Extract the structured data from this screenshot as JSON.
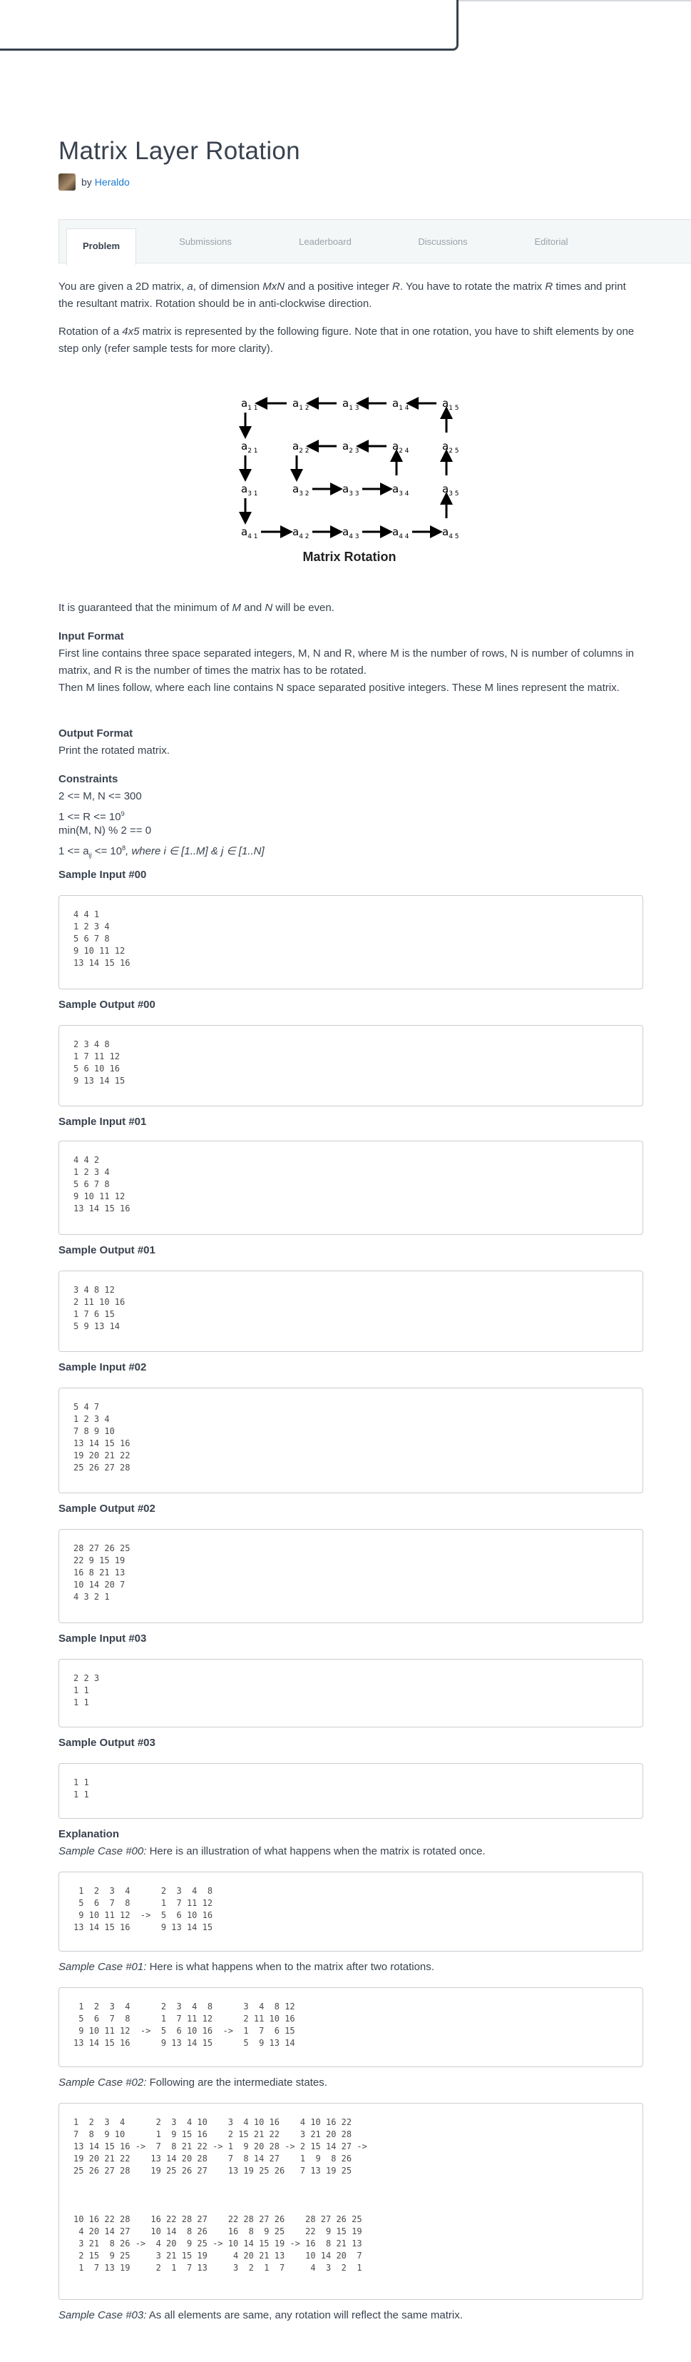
{
  "title": "Matrix Layer Rotation",
  "byline": {
    "prefix": "by",
    "author": "Heraldo"
  },
  "tabs": [
    "Problem",
    "Submissions",
    "Leaderboard",
    "Discussions",
    "Editorial"
  ],
  "intro": {
    "p1a": "You are given a 2D matrix, ",
    "p1_a": "a",
    "p1b": ", of dimension ",
    "p1_mxn": "MxN",
    "p1c": " and a positive integer ",
    "p1_r": "R",
    "p1d": ". You have to rotate the matrix ",
    "p1_r2": "R",
    "p1e": " times and print the resultant matrix. Rotation should be in anti-clockwise direction.",
    "p2a": "Rotation of a ",
    "p2_4x5": "4x5",
    "p2b": " matrix is represented by the following figure. Note that in one rotation, you have to shift elements by one step only (refer sample tests for more clarity)."
  },
  "figure": {
    "caption": "Matrix Rotation"
  },
  "guarantee": {
    "a": "It is guaranteed that the minimum of ",
    "m": "M",
    "b": " and ",
    "n": "N",
    "c": " will be even."
  },
  "input_format": {
    "heading": "Input Format",
    "l1": "First line contains three space separated integers, M, N and R, where M is the number of rows, N is number of columns in matrix, and R is the number of times the matrix has to be rotated.",
    "l2": "Then M lines follow, where each line contains N space separated positive integers. These M lines represent the matrix."
  },
  "output_format": {
    "heading": "Output Format",
    "text": "Print the rotated matrix."
  },
  "constraints": {
    "heading": "Constraints",
    "c1": "2 <= M, N <= 300",
    "c2": "1 <= R <= 10",
    "c2_sup": "9",
    "c3": "min(M, N) % 2 == 0",
    "c4a": "1 <= a",
    "c4_sub": "ij",
    "c4b": " <= 10",
    "c4_sup": "8",
    "c4c": ", where i ∈ [1..M] & j ∈ [1..N]"
  },
  "samples": [
    {
      "heading": "Sample Input #00",
      "code": "4 4 1\n1 2 3 4\n5 6 7 8\n9 10 11 12\n13 14 15 16"
    },
    {
      "heading": "Sample Output #00",
      "code": "2 3 4 8\n1 7 11 12\n5 6 10 16\n9 13 14 15"
    },
    {
      "heading": "Sample Input #01",
      "code": "4 4 2\n1 2 3 4\n5 6 7 8\n9 10 11 12\n13 14 15 16"
    },
    {
      "heading": "Sample Output #01",
      "code": "3 4 8 12\n2 11 10 16\n1 7 6 15\n5 9 13 14"
    },
    {
      "heading": "Sample Input #02",
      "code": "5 4 7\n1 2 3 4\n7 8 9 10\n13 14 15 16\n19 20 21 22\n25 26 27 28"
    },
    {
      "heading": "Sample Output #02",
      "code": "28 27 26 25\n22 9 15 19\n16 8 21 13\n10 14 20 7\n4 3 2 1"
    },
    {
      "heading": "Sample Input #03",
      "code": "2 2 3\n1 1\n1 1"
    },
    {
      "heading": "Sample Output #03",
      "code": "1 1\n1 1"
    }
  ],
  "explanation": {
    "heading": "Explanation",
    "case0_label": "Sample Case #00:",
    "case0_text": " Here is an illustration of what happens when the matrix is rotated once.",
    "case0_code": " 1  2  3  4      2  3  4  8\n 5  6  7  8      1  7 11 12\n 9 10 11 12  ->  5  6 10 16\n13 14 15 16      9 13 14 15",
    "case1_label": "Sample Case #01:",
    "case1_text": " Here is what happens when to the matrix after two rotations.",
    "case1_code": " 1  2  3  4      2  3  4  8      3  4  8 12\n 5  6  7  8      1  7 11 12      2 11 10 16\n 9 10 11 12  ->  5  6 10 16  ->  1  7  6 15\n13 14 15 16      9 13 14 15      5  9 13 14",
    "case2_label": "Sample Case #02:",
    "case2_text": " Following are the intermediate states.",
    "case2_code": "1  2  3  4      2  3  4 10    3  4 10 16    4 10 16 22\n7  8  9 10      1  9 15 16    2 15 21 22    3 21 20 28\n13 14 15 16 ->  7  8 21 22 -> 1  9 20 28 -> 2 15 14 27 ->\n19 20 21 22    13 14 20 28    7  8 14 27    1  9  8 26\n25 26 27 28    19 25 26 27    13 19 25 26   7 13 19 25\n\n\n\n10 16 22 28    16 22 28 27    22 28 27 26    28 27 26 25\n 4 20 14 27    10 14  8 26    16  8  9 25    22  9 15 19\n 3 21  8 26 ->  4 20  9 25 -> 10 14 15 19 -> 16  8 21 13\n 2 15  9 25     3 21 15 19     4 20 21 13    10 14 20  7\n 1  7 13 19     2  1  7 13     3  2  1  7     4  3  2  1",
    "case3_label": "Sample Case #03:",
    "case3_text": " As all elements are same, any rotation will reflect the same matrix."
  }
}
